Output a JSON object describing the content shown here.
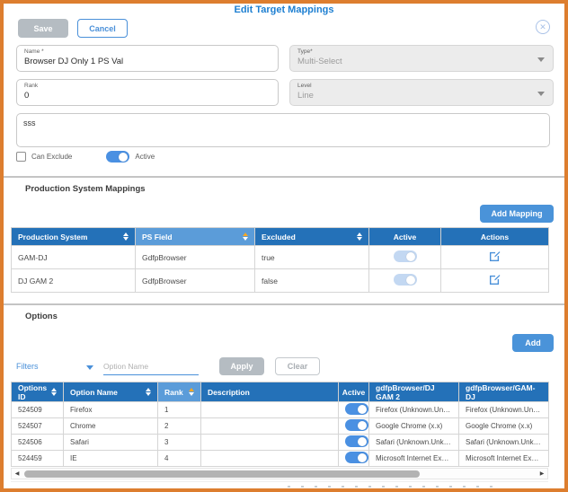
{
  "dialog": {
    "title": "Edit Target Mappings",
    "buttons": {
      "save": "Save",
      "cancel": "Cancel"
    },
    "close_icon": "✕"
  },
  "form": {
    "name": {
      "label": "Name *",
      "value": "Browser DJ Only 1 PS Val"
    },
    "type": {
      "label": "Type*",
      "value": "Multi-Select"
    },
    "rank": {
      "label": "Rank",
      "value": "0"
    },
    "level": {
      "label": "Level",
      "value": "Line"
    },
    "notes_value": "sss",
    "can_exclude": {
      "label": "Can Exclude",
      "checked": false
    },
    "active": {
      "label": "Active",
      "on": true
    }
  },
  "ps_mappings": {
    "heading": "Production System Mappings",
    "add_button": "Add Mapping",
    "columns": {
      "production_system": "Production System",
      "ps_field": "PS Field",
      "excluded": "Excluded",
      "active": "Active",
      "actions": "Actions"
    },
    "sorted_column": "PS Field",
    "rows": [
      {
        "production_system": "GAM-DJ",
        "ps_field": "GdfpBrowser",
        "excluded": "true",
        "active_on": false
      },
      {
        "production_system": "DJ GAM 2",
        "ps_field": "GdfpBrowser",
        "excluded": "false",
        "active_on": false
      }
    ]
  },
  "options": {
    "heading": "Options",
    "add_button": "Add",
    "filters": {
      "label": "Filters",
      "option_name_placeholder": "Option Name",
      "apply_button": "Apply",
      "clear_button": "Clear"
    },
    "columns": {
      "id": "Options ID",
      "name": "Option Name",
      "rank": "Rank",
      "description": "Description",
      "active": "Active",
      "mapping1": "gdfpBrowser/DJ GAM 2",
      "mapping2": "gdfpBrowser/GAM-DJ"
    },
    "sorted_column": "Rank",
    "rows": [
      {
        "id": "524509",
        "name": "Firefox",
        "rank": "1",
        "description": "",
        "active_on": true,
        "mapping1": "Firefox (Unknown.Unkno...",
        "mapping2": "Firefox (Unknown.Unkn..."
      },
      {
        "id": "524507",
        "name": "Chrome",
        "rank": "2",
        "description": "",
        "active_on": true,
        "mapping1": "Google Chrome (x.x)",
        "mapping2": "Google Chrome (x.x)"
      },
      {
        "id": "524506",
        "name": "Safari",
        "rank": "3",
        "description": "",
        "active_on": true,
        "mapping1": "Safari (Unknown.Unknown)",
        "mapping2": "Safari (Unknown.Unkno..."
      },
      {
        "id": "524459",
        "name": "IE",
        "rank": "4",
        "description": "",
        "active_on": true,
        "mapping1": "Microsoft Internet Explore...",
        "mapping2": "Microsoft Internet Explo..."
      }
    ]
  },
  "scrollbar": {
    "left_arrow": "◀",
    "right_arrow": "▶"
  },
  "colors": {
    "accent_blue": "#4a90d9",
    "header_blue": "#2471b8",
    "sorted_header_blue": "#5b9cd9",
    "border_orange": "#dd7e2f",
    "disabled_gray": "#b5bcc2",
    "toggle_on": "#4a90e2",
    "toggle_disabled": "#c3d8f2",
    "sort_active_arrow": "#f5a623"
  }
}
